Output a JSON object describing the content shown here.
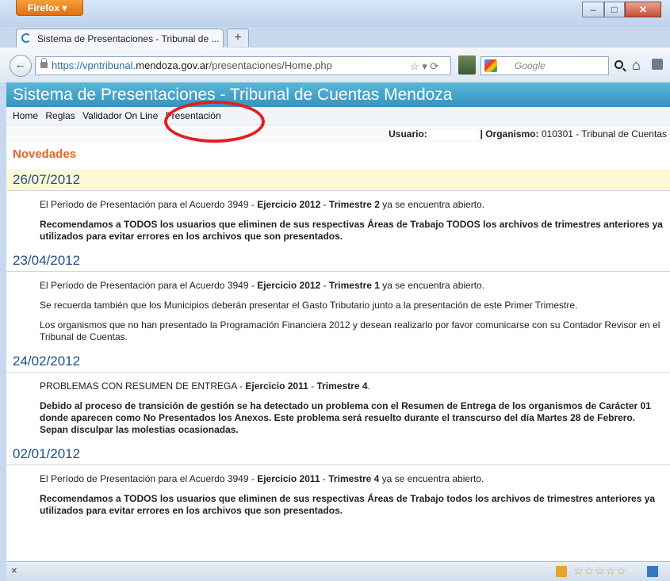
{
  "browser": {
    "app_button": "Firefox",
    "tab_title": "Sistema de Presentaciones - Tribunal de ...",
    "new_tab": "+",
    "url_prefix": "https://vpntribunal.",
    "url_host": "mendoza.gov.ar",
    "url_path": "/presentaciones/Home.php",
    "search_placeholder": "Google",
    "status_close": "×"
  },
  "site": {
    "banner": "Sistema de Presentaciones - Tribunal de Cuentas Mendoza",
    "menu": [
      "Home",
      "Reglas",
      "Validador On Line",
      "Presentación"
    ],
    "user_label": "Usuario:",
    "org_label": "| Organismo:",
    "org_value": " 010301 - Tribunal de Cuentas",
    "novedades": "Novedades"
  },
  "news": [
    {
      "date": "26/07/2012",
      "p1_a": "El Período de Presentación para el Acuerdo 3949 - ",
      "p1_b": "Ejercicio 2012",
      "p1_c": " - ",
      "p1_d": "Trimestre 2",
      "p1_e": " ya se encuentra abierto.",
      "p2": "Recomendamos a TODOS los usuarios que eliminen de sus respectivas Áreas de Trabajo TODOS los archivos de trimestres anteriores ya utilizados para evitar errores en los archivos que son presentados."
    },
    {
      "date": "23/04/2012",
      "p1_a": "El Período de Presentación para el Acuerdo 3949 - ",
      "p1_b": "Ejercicio 2012",
      "p1_c": " - ",
      "p1_d": "Trimestre 1",
      "p1_e": " ya se encuentra abierto.",
      "p2": "Se recuerda también que los Municipios deberán presentar el Gasto Tributario junto a la presentación de este Primer Trimestre.",
      "p3": "Los organismos que no han presentado la Programación Financiera 2012 y desean realizarlo por favor comunicarse con su Contador Revisor en el Tribunal de Cuentas."
    },
    {
      "date": "24/02/2012",
      "p1_a": "PROBLEMAS CON RESUMEN DE ENTREGA - ",
      "p1_b": "Ejercicio 2011",
      "p1_c": " - ",
      "p1_d": "Trimestre 4",
      "p1_e": ".",
      "p2": "Debido al proceso de transición de gestión se ha detectado un problema con el Resumen de Entrega de los organismos de Carácter 01 donde aparecen como No Presentados los Anexos. Este problema será resuelto durante el transcurso del día Martes 28 de Febrero. Sepan disculpar las molestias ocasionadas."
    },
    {
      "date": "02/01/2012",
      "p1_a": "El Período de Presentación para el Acuerdo 3949 - ",
      "p1_b": "Ejercicio 2011",
      "p1_c": " - ",
      "p1_d": "Trimestre 4",
      "p1_e": " ya se encuentra abierto.",
      "p2": "Recomendamos a TODOS los usuarios que eliminen de sus respectivas Áreas de Trabajo todos los archivos de trimestres anteriores ya utilizados para evitar errores en los archivos que son presentados."
    }
  ],
  "colors": {
    "banner": "#3594bf",
    "accent": "#e8632a",
    "date": "#1e4f8c",
    "highlight": "#e31e24"
  }
}
